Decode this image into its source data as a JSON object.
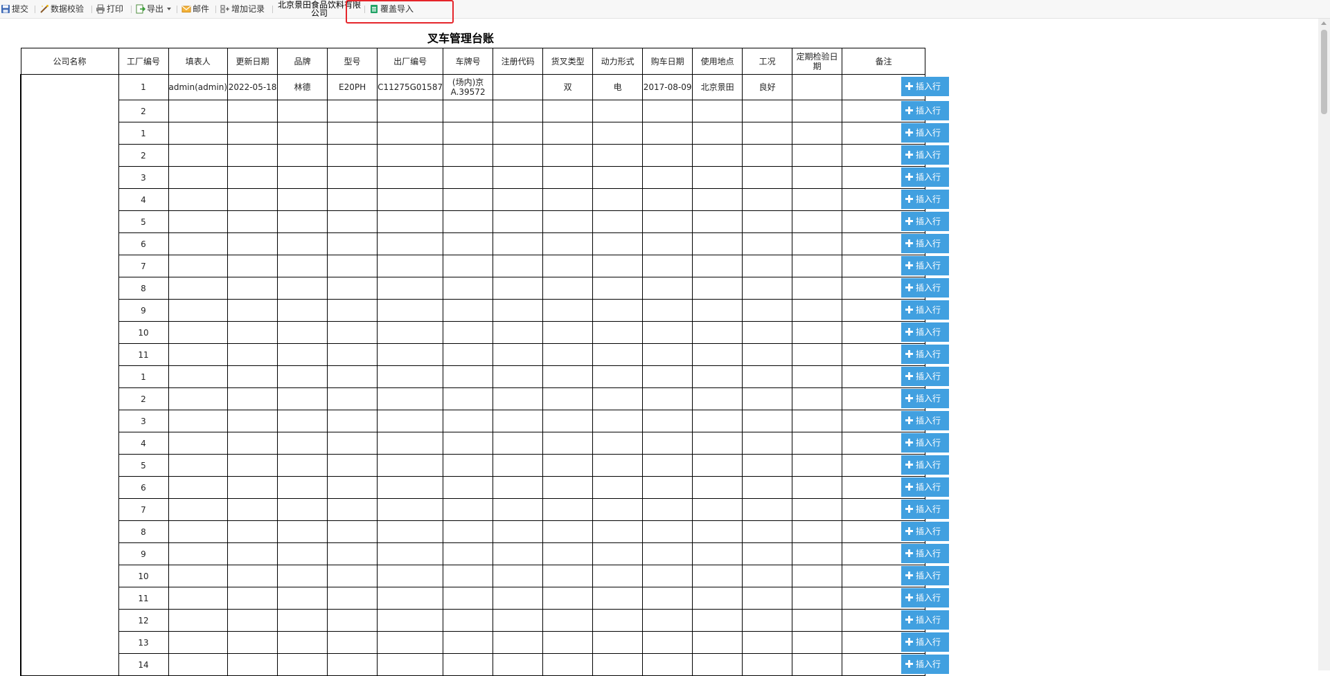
{
  "toolbar": {
    "submit": "提交",
    "validate": "数据校验",
    "print": "打印",
    "export": "导出",
    "mail": "邮件",
    "add_record": "增加记录",
    "company": "北京景田食品饮料有限公司",
    "overwrite_import": "覆盖导入"
  },
  "report": {
    "title": "叉车管理台账",
    "columns": [
      "公司名称",
      "工厂编号",
      "填表人",
      "更新日期",
      "品牌",
      "型号",
      "出厂编号",
      "车牌号",
      "注册代码",
      "货叉类型",
      "动力形式",
      "购车日期",
      "使用地点",
      "工况",
      "定期检验日期",
      "备注"
    ],
    "rows": [
      {
        "company": "",
        "no": "1",
        "filler": "admin(admin)",
        "update_date": "2022-05-18",
        "brand": "林德",
        "model": "E20PH",
        "serial": "C11275G01587",
        "plate": "(场内)京A.39572",
        "reg_code": "",
        "fork_type": "双",
        "power": "电",
        "purchase_date": "2017-08-09",
        "location": "北京景田",
        "condition": "良好",
        "inspect_date": "",
        "remark": ""
      },
      {
        "no": "2"
      },
      {
        "no": "1"
      },
      {
        "no": "2"
      },
      {
        "no": "3"
      },
      {
        "no": "4"
      },
      {
        "no": "5"
      },
      {
        "no": "6"
      },
      {
        "no": "7"
      },
      {
        "no": "8"
      },
      {
        "no": "9"
      },
      {
        "no": "10"
      },
      {
        "no": "11"
      },
      {
        "no": "1"
      },
      {
        "no": "2"
      },
      {
        "no": "3"
      },
      {
        "no": "4"
      },
      {
        "no": "5"
      },
      {
        "no": "6"
      },
      {
        "no": "7"
      },
      {
        "no": "8"
      },
      {
        "no": "9"
      },
      {
        "no": "10"
      },
      {
        "no": "11"
      },
      {
        "no": "12"
      },
      {
        "no": "13"
      },
      {
        "no": "14"
      }
    ],
    "insert_label": "插入行"
  },
  "colors": {
    "insert_button": "#41a0e0",
    "highlight": "#e5242a"
  },
  "icons": {
    "submit": "save-icon",
    "validate": "wand-icon",
    "print": "printer-icon",
    "export": "export-icon",
    "mail": "envelope-icon",
    "add_record": "add-record-icon",
    "overwrite_import": "spreadsheet-icon"
  }
}
